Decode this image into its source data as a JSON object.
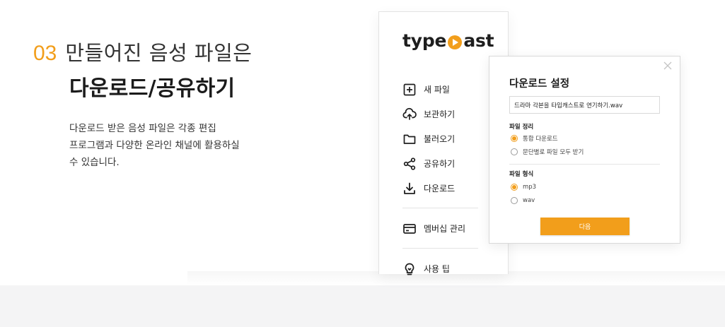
{
  "headline": {
    "step": "03",
    "line1": "만들어진 음성 파일은",
    "line2": "다운로드/공유하기"
  },
  "description": {
    "line1": "다운로드 받은 음성 파일은 각종 편집",
    "line2": "프로그램과 다양한 온라인 채널에 활용하실",
    "line3": "수 있습니다."
  },
  "app": {
    "logo_left": "type",
    "logo_right": "ast",
    "brand_color": "#f29e1b",
    "menu": [
      {
        "label": "새 파일",
        "icon": "plus-square-icon"
      },
      {
        "label": "보관하기",
        "icon": "cloud-upload-icon"
      },
      {
        "label": "불러오기",
        "icon": "folder-icon"
      },
      {
        "label": "공유하기",
        "icon": "share-icon"
      },
      {
        "label": "다운로드",
        "icon": "download-icon"
      },
      {
        "label": "멤버십 관리",
        "icon": "card-icon"
      },
      {
        "label": "사용 팁",
        "icon": "lightbulb-icon"
      }
    ]
  },
  "dialog": {
    "title": "다운로드 설정",
    "filename": "드라마 각본을 타입캐스트로 연기하기.wav",
    "file_arrange": {
      "title": "파일 정리",
      "options": [
        "통합 다운로드",
        "문단별로 파일 모두 받기"
      ],
      "selected": 0
    },
    "file_format": {
      "title": "파일 형식",
      "options": [
        "mp3",
        "wav"
      ],
      "selected": 0
    },
    "next_label": "다음"
  }
}
